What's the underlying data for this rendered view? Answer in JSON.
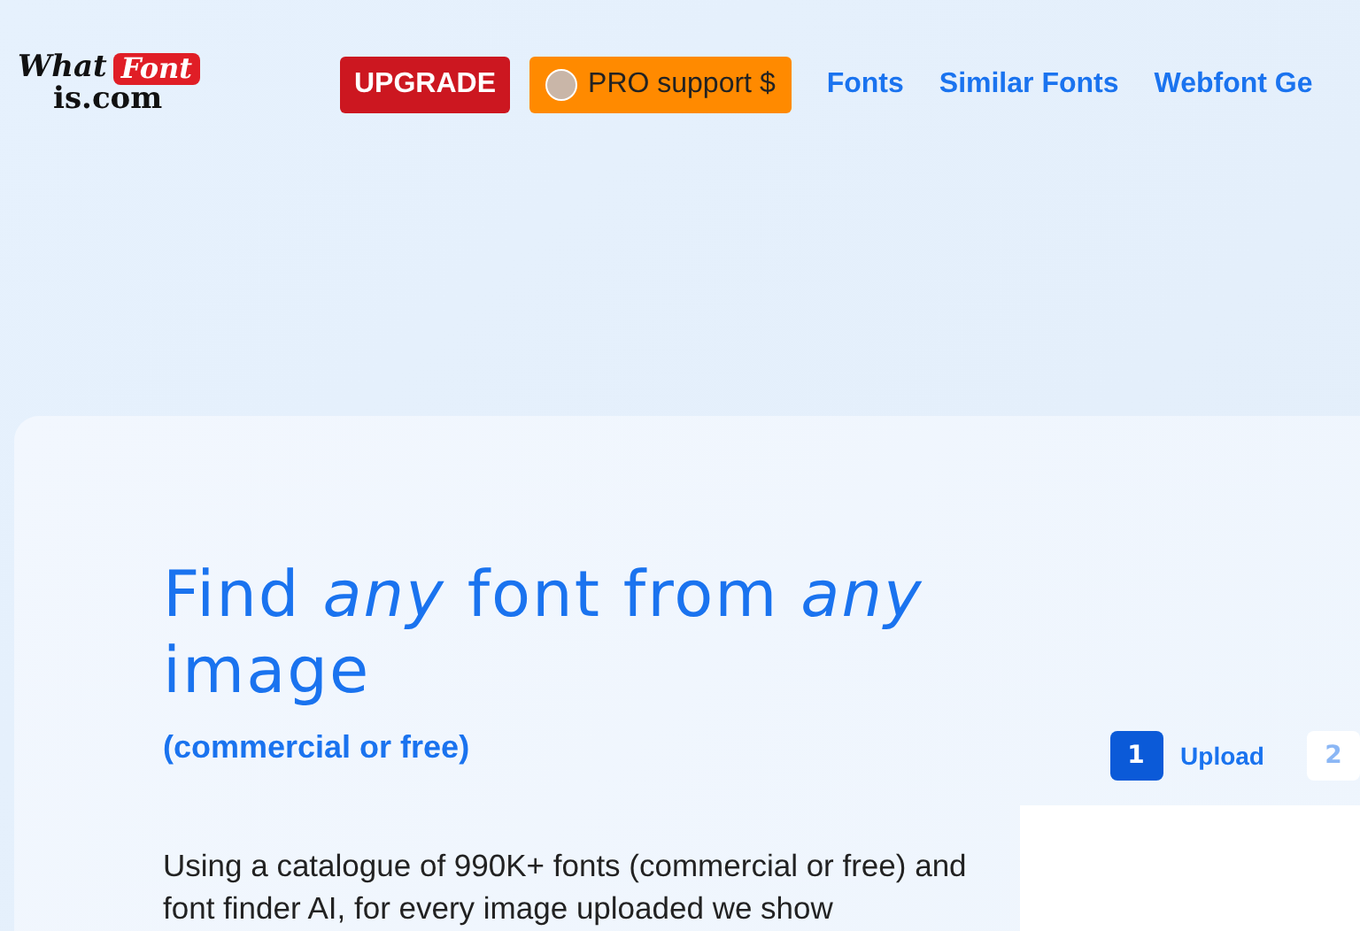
{
  "header": {
    "logo": {
      "word_1": "What",
      "word_2": "Font",
      "word_3": "is.com"
    },
    "upgrade_button": "UPGRADE",
    "pro_button": "PRO support $",
    "nav": [
      {
        "label": "Fonts"
      },
      {
        "label": "Similar Fonts"
      },
      {
        "label": "Webfont Ge"
      }
    ]
  },
  "hero": {
    "title": "Find *any* font from *any* image",
    "subtitle": "(commercial or free)",
    "description": "Using a catalogue of 990K+ fonts (commercial or free) and font finder AI, for every image uploaded we show"
  },
  "steps": [
    {
      "number": "1",
      "label": "Upload",
      "selected": true
    },
    {
      "number": "2",
      "selected": false
    }
  ]
}
